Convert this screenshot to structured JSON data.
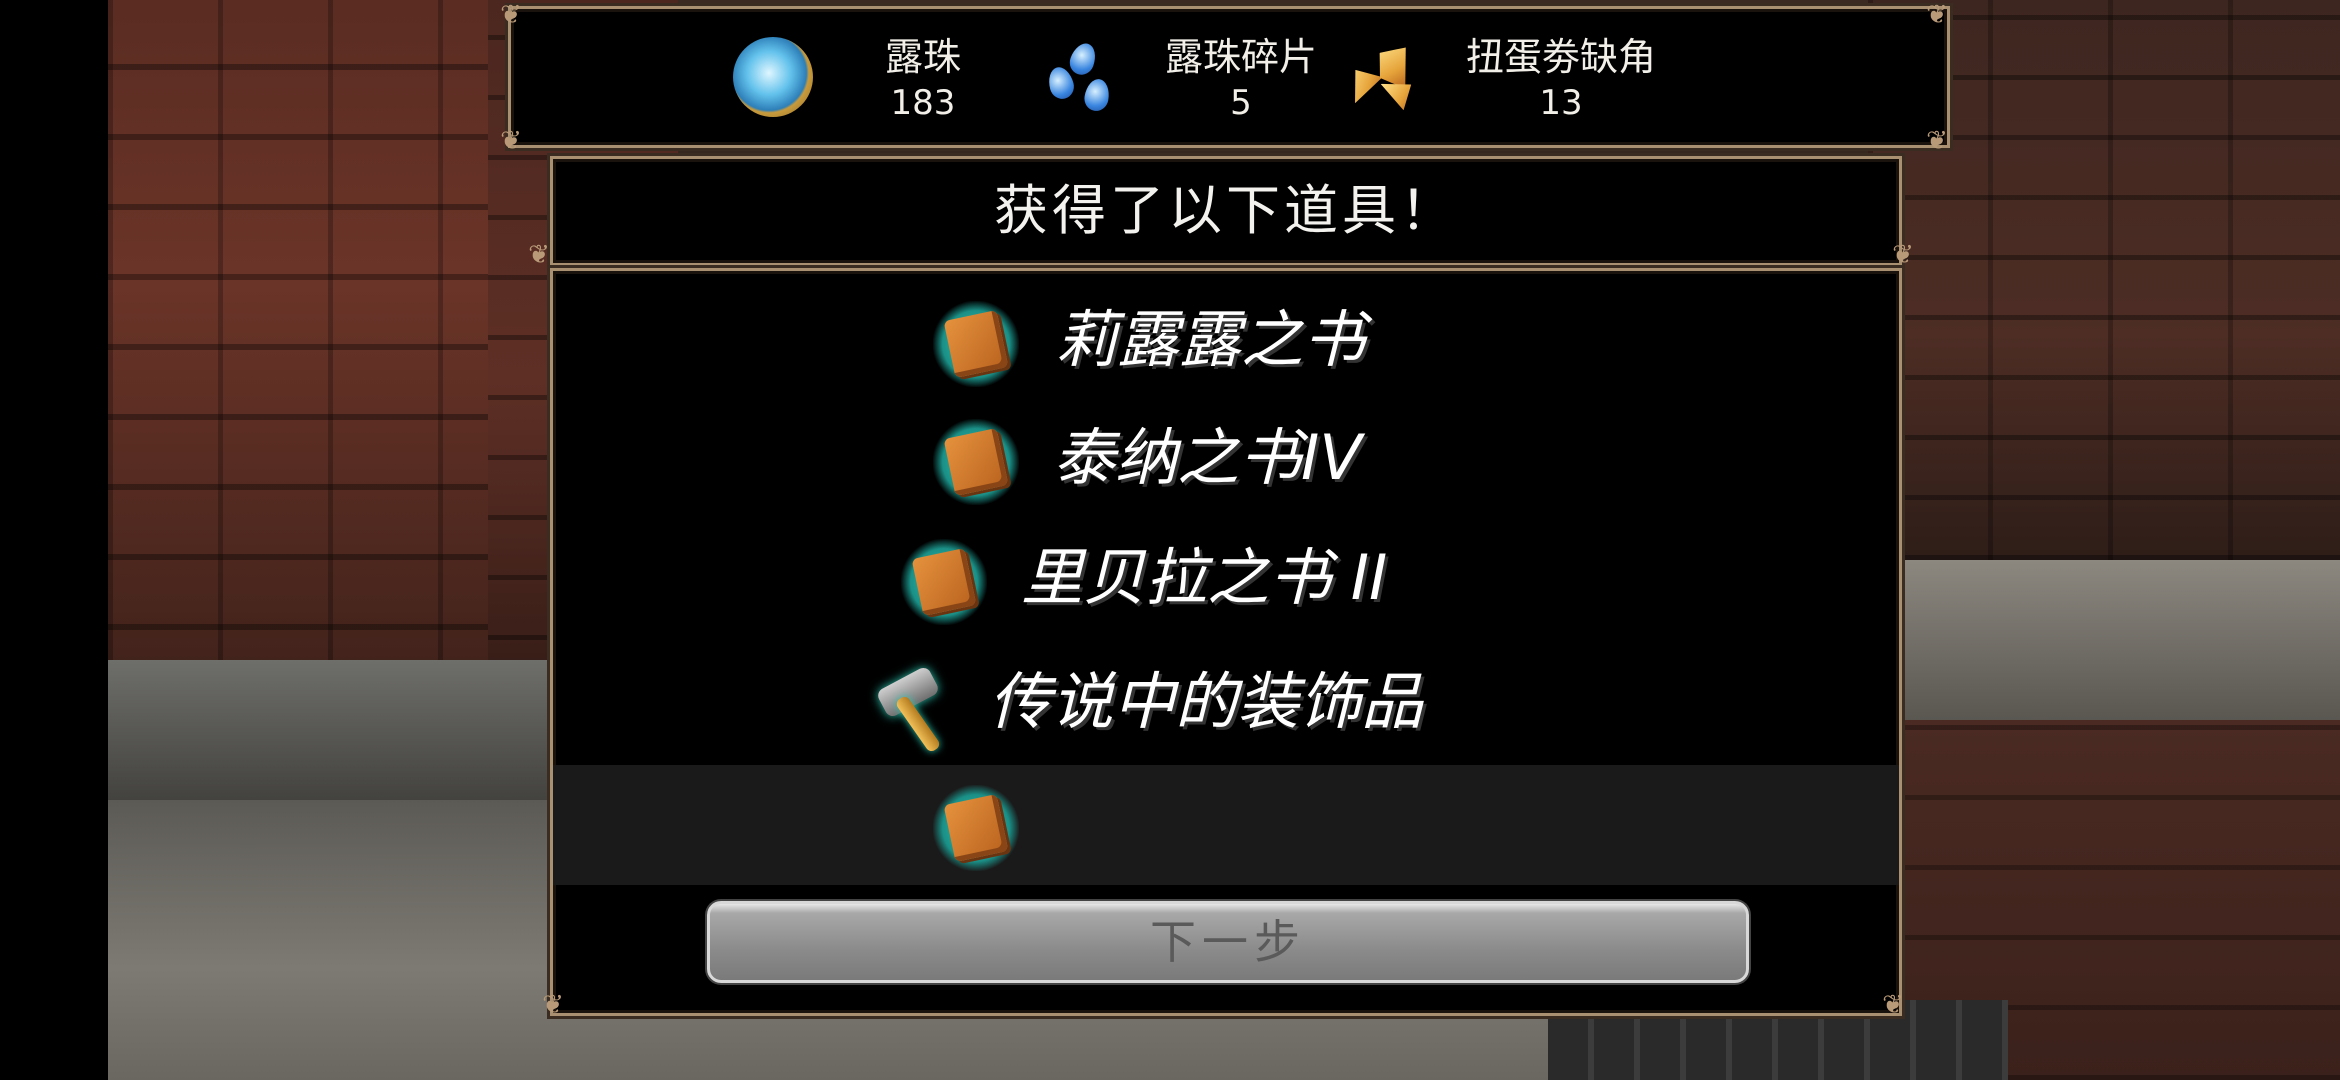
{
  "currencies": [
    {
      "name": "露珠",
      "value": "183",
      "icon": "dew-orb-icon"
    },
    {
      "name": "露珠碎片",
      "value": "5",
      "icon": "dew-fragment-icon"
    },
    {
      "name": "扭蛋劵缺角",
      "value": "13",
      "icon": "gacha-ticket-shard-icon"
    }
  ],
  "dialog": {
    "title": "获得了以下道具！",
    "items": [
      {
        "label": "莉露露之书",
        "icon": "book-icon"
      },
      {
        "label": "泰纳之书IV",
        "icon": "book-icon"
      },
      {
        "label": "里贝拉之书 II",
        "icon": "book-icon"
      },
      {
        "label": "传说中的装饰品",
        "icon": "hammer-icon"
      },
      {
        "label": "",
        "icon": "book-icon"
      }
    ],
    "next_button": "下一步"
  },
  "colors": {
    "frame_border": "#a89070",
    "panel_bg": "#000000",
    "text": "#ffffff",
    "button_bg": "#8b8b8b",
    "icon_glow": "#2bc7b0"
  }
}
